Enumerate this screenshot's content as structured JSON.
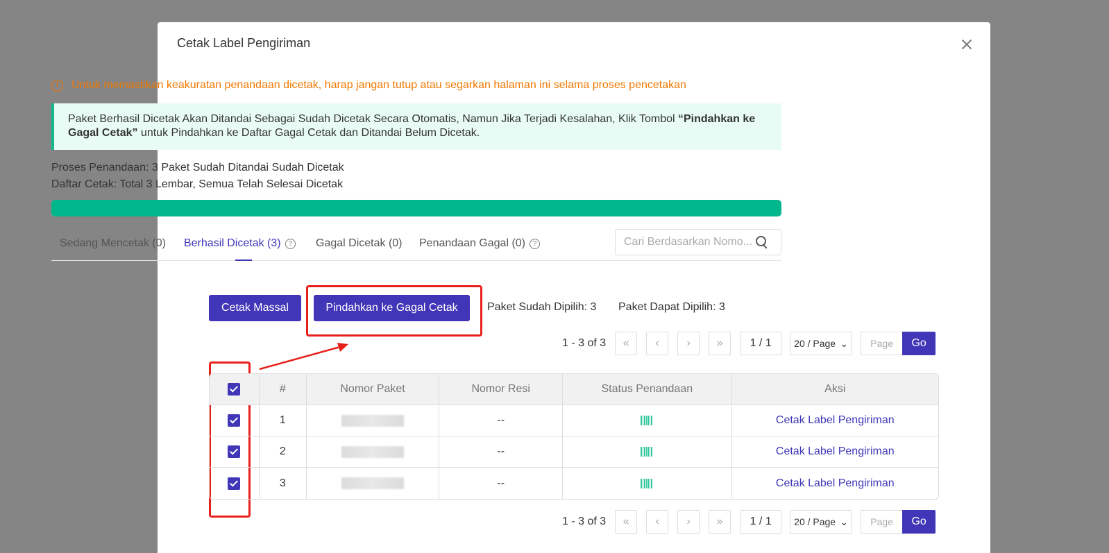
{
  "modal": {
    "title": "Cetak Label Pengiriman",
    "warning": "Untuk memastikan keakuratan penandaan dicetak, harap jangan tutup atau segarkan halaman ini selama proses pencetakan",
    "info_text_1": "Paket Berhasil Dicetak Akan Ditandai Sebagai Sudah Dicetak Secara Otomatis, Namun Jika Terjadi Kesalahan, Klik Tombol ",
    "info_bold": "“Pindahkan ke Gagal Cetak”",
    "info_text_2": " untuk Pindahkan ke Daftar Gagal Cetak dan Ditandai Belum Dicetak.",
    "status_line_1": "Proses Penandaan: 3 Paket Sudah Ditandai Sudah Dicetak",
    "status_line_2": "Daftar Cetak: Total 3 Lembar, Semua Telah Selesai Dicetak",
    "progress_percent": 100,
    "colors": {
      "accent": "#4135b8",
      "progress": "#00b78c",
      "warning": "#f07800",
      "highlight": "#e8201c"
    }
  },
  "tabs": [
    {
      "label": "Sedang Mencetak (0)"
    },
    {
      "label": "Berhasil Dicetak (3)",
      "active": true,
      "help": "?"
    },
    {
      "label": "Gagal Dicetak (0)"
    },
    {
      "label": "Penandaan Gagal (0)",
      "help": "?"
    }
  ],
  "search": {
    "placeholder": "Cari Berdasarkan Nomo..."
  },
  "actions": {
    "bulk_print": "Cetak Massal",
    "move_to_failed": "Pindahkan ke Gagal Cetak",
    "selected": "Paket Sudah Dipilih: 3",
    "selectable": "Paket Dapat Dipilih: 3"
  },
  "pagination": {
    "range": "1 - 3 of 3",
    "page": "1 / 1",
    "page_size": "20 / Page",
    "page_placeholder": "Page",
    "go": "Go"
  },
  "table": {
    "headers": [
      "#",
      "Nomor Paket",
      "Nomor Resi",
      "Status Penandaan",
      "Aksi"
    ],
    "rows": [
      {
        "no": "1",
        "resi": "--",
        "action": "Cetak Label Pengiriman"
      },
      {
        "no": "2",
        "resi": "--",
        "action": "Cetak Label Pengiriman"
      },
      {
        "no": "3",
        "resi": "--",
        "action": "Cetak Label Pengiriman"
      }
    ]
  }
}
